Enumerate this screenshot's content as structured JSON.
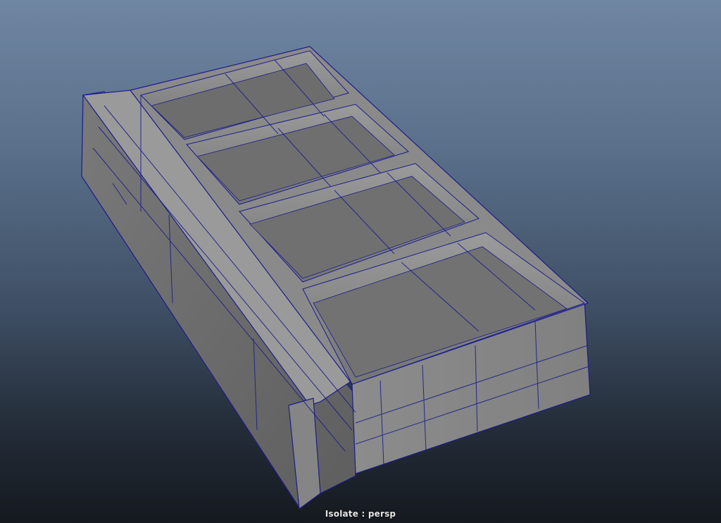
{
  "viewport": {
    "camera_label": "Isolate : persp",
    "background_top": "#6f86a2",
    "background_bottom": "#15191f",
    "mesh_face_color": "#8f8f8f",
    "mesh_shadow_color": "#5c5c5c",
    "wireframe_color": "#1c1c8c"
  },
  "model": {
    "type": "tray with four compartments",
    "compartment_count": 4
  }
}
